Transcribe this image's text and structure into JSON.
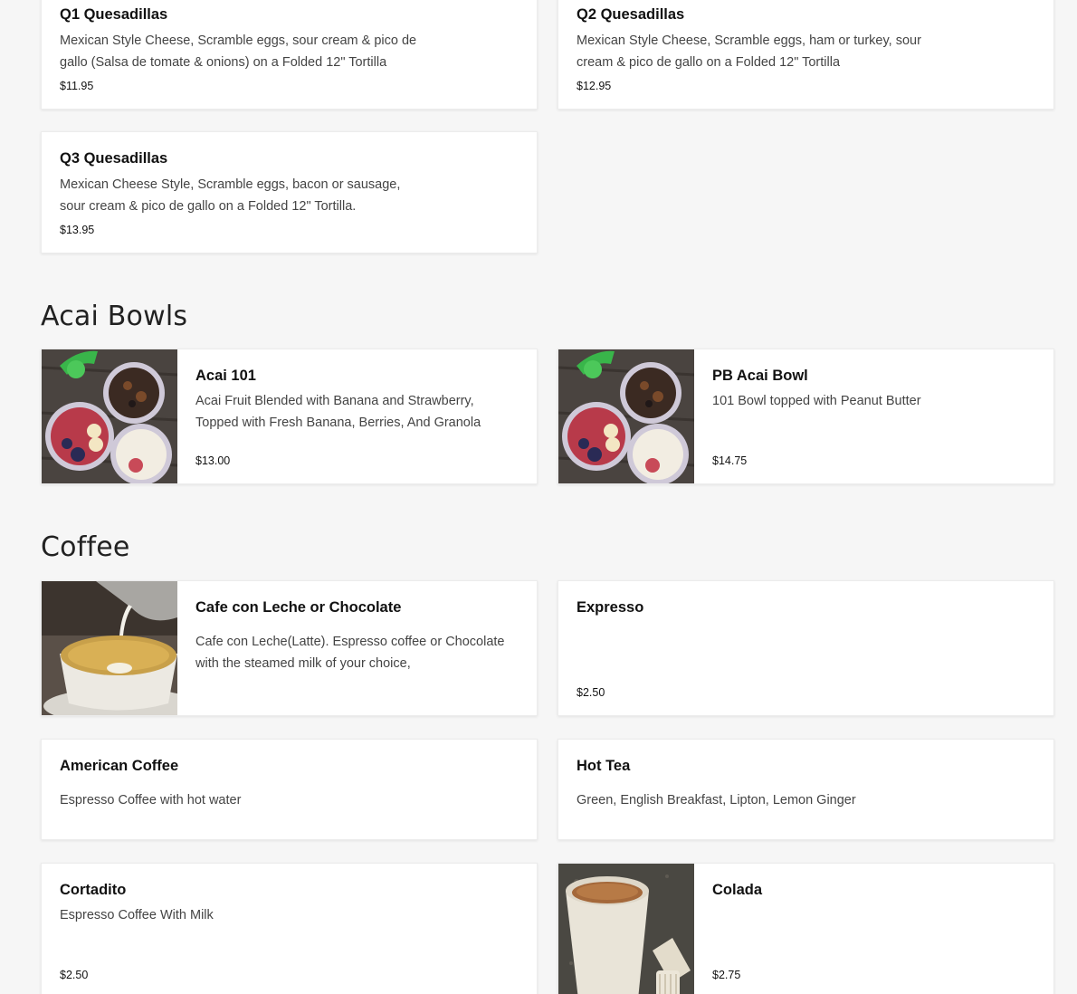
{
  "quesadillas": [
    {
      "name": "Q1 Quesadillas",
      "description": "Mexican Style Cheese, Scramble eggs, sour cream & pico de gallo (Salsa de tomate & onions) on a Folded 12\" Tortilla",
      "price": "$11.95"
    },
    {
      "name": "Q2 Quesadillas",
      "description": "Mexican Style Cheese, Scramble eggs, ham or turkey, sour cream & pico de gallo on a Folded 12\" Tortilla",
      "price": "$12.95"
    },
    {
      "name": "Q3 Quesadillas",
      "description": "Mexican Cheese Style, Scramble eggs, bacon or sausage, sour cream & pico de gallo on a Folded 12\" Tortilla.",
      "price": "$13.95"
    }
  ],
  "acai_section": {
    "title": "Acai Bowls",
    "items": [
      {
        "name": "Acai 101",
        "description": "Acai Fruit Blended with Banana and Strawberry, Topped with Fresh Banana, Berries, And Granola",
        "price": "$13.00",
        "image_icon": "acai-bowl-photo"
      },
      {
        "name": "PB Acai Bowl",
        "description": "101 Bowl topped with Peanut Butter",
        "price": "$14.75",
        "image_icon": "acai-bowl-photo"
      }
    ]
  },
  "coffee_section": {
    "title": "Coffee",
    "items": [
      {
        "name": "Cafe con Leche or Chocolate",
        "description": "Cafe con Leche(Latte). Espresso coffee or Chocolate with the steamed milk of your choice,",
        "image_icon": "latte-pour-photo"
      },
      {
        "name": "Expresso",
        "price": "$2.50"
      },
      {
        "name": "American Coffee",
        "description": "Espresso Coffee with hot water"
      },
      {
        "name": "Hot Tea",
        "description": "Green, English Breakfast, Lipton, Lemon Ginger"
      },
      {
        "name": "Cortadito",
        "description": "Espresso Coffee With Milk",
        "price": "$2.50"
      },
      {
        "name": "Colada",
        "price": "$2.75",
        "image_icon": "colada-cup-photo"
      }
    ]
  }
}
